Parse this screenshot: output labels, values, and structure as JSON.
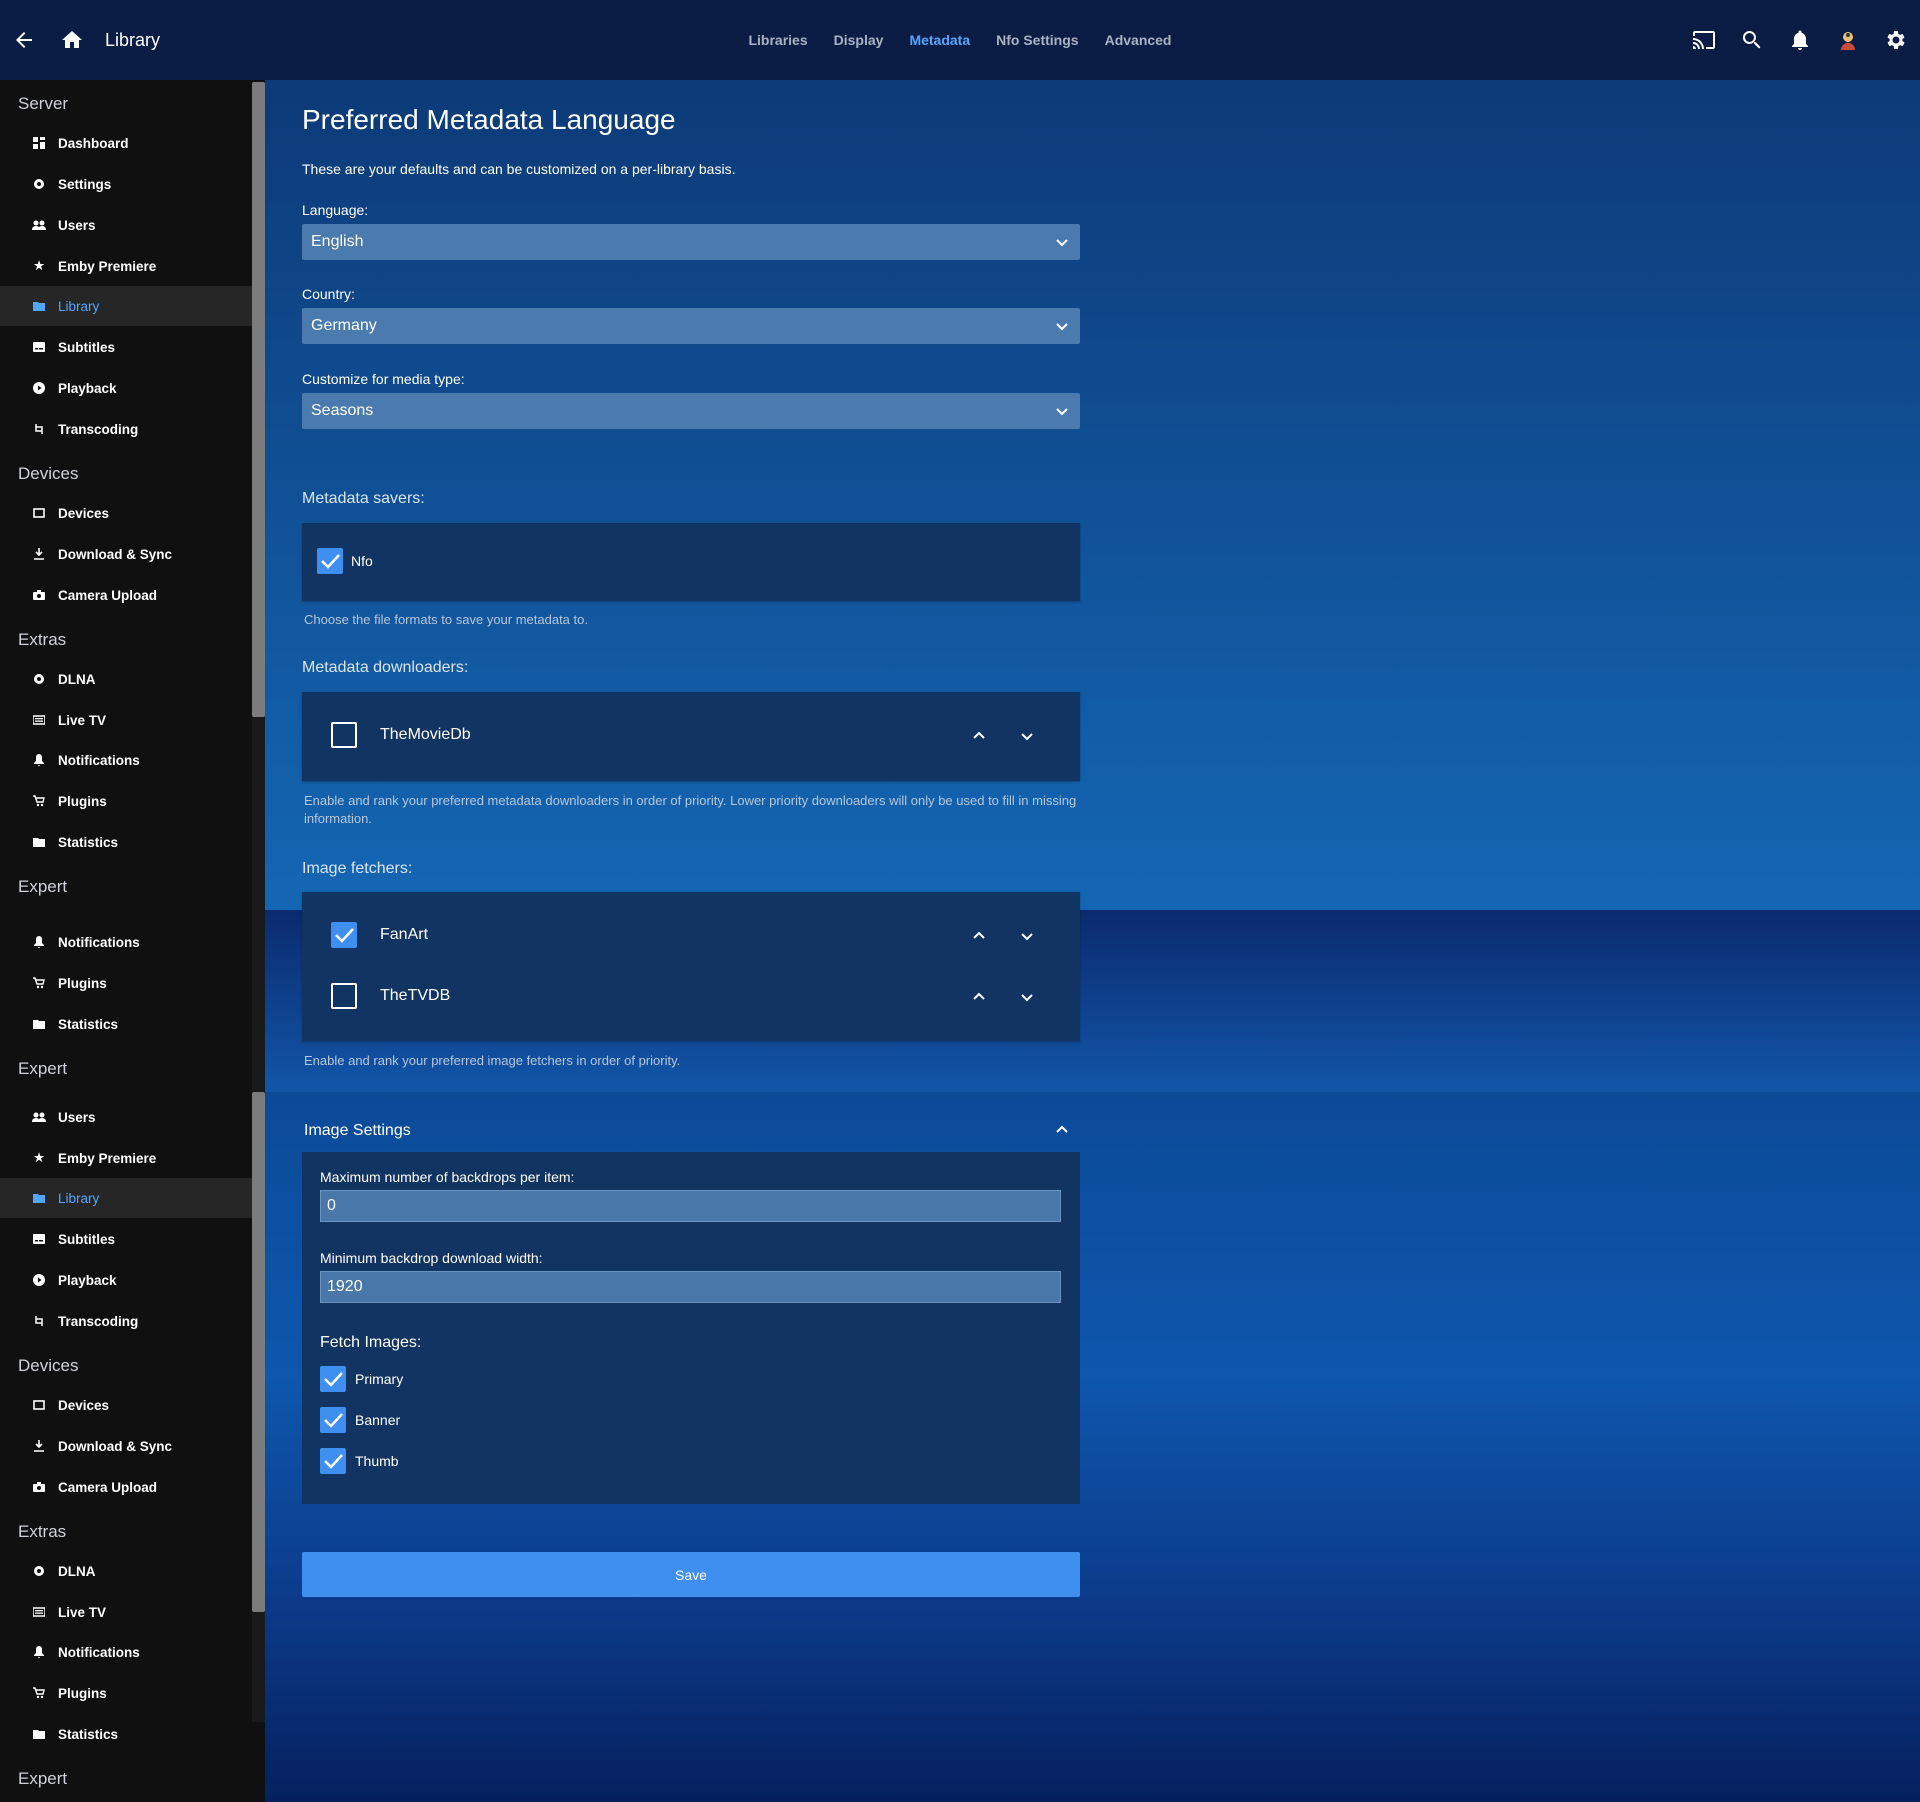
{
  "header": {
    "title": "Library",
    "tabs": [
      "Libraries",
      "Display",
      "Metadata",
      "Nfo Settings",
      "Advanced"
    ],
    "active_tab": "Metadata"
  },
  "sidebar": {
    "sections": [
      {
        "title": "Server",
        "items": [
          "Dashboard",
          "Settings",
          "Users",
          "Emby Premiere",
          "Library",
          "Subtitles",
          "Playback",
          "Transcoding"
        ]
      },
      {
        "title": "Devices",
        "items": [
          "Devices",
          "Download & Sync",
          "Camera Upload"
        ]
      },
      {
        "title": "Extras",
        "items": [
          "DLNA",
          "Live TV",
          "Notifications",
          "Plugins",
          "Statistics"
        ]
      },
      {
        "title": "Expert",
        "items": [
          "Notifications",
          "Plugins",
          "Statistics"
        ]
      },
      {
        "title": "Expert",
        "items": [
          "Users",
          "Emby Premiere",
          "Library",
          "Subtitles",
          "Playback",
          "Transcoding"
        ]
      },
      {
        "title": "Devices",
        "items": [
          "Devices",
          "Download & Sync",
          "Camera Upload"
        ]
      },
      {
        "title": "Extras",
        "items": [
          "DLNA",
          "Live TV",
          "Notifications",
          "Plugins",
          "Statistics"
        ]
      },
      {
        "title": "Expert",
        "items": []
      }
    ],
    "active_item": "Library"
  },
  "main": {
    "title": "Preferred Metadata Language",
    "description": "These are your defaults and can be customized on a per-library basis.",
    "language": {
      "label": "Language:",
      "value": "English"
    },
    "country": {
      "label": "Country:",
      "value": "Germany"
    },
    "media_type": {
      "label": "Customize for media type:",
      "value": "Seasons"
    },
    "metadata_savers": {
      "title": "Metadata savers:",
      "items": [
        {
          "label": "Nfo",
          "checked": true
        }
      ],
      "hint": "Choose the file formats to save your metadata to."
    },
    "metadata_downloaders": {
      "title": "Metadata downloaders:",
      "items": [
        {
          "label": "TheMovieDb",
          "checked": false
        }
      ],
      "hint": "Enable and rank your preferred metadata downloaders in order of priority. Lower priority downloaders will only be used to fill in missing information."
    },
    "image_fetchers": {
      "title": "Image fetchers:",
      "items": [
        {
          "label": "FanArt",
          "checked": true
        },
        {
          "label": "TheTVDB",
          "checked": false
        }
      ],
      "hint": "Enable and rank your preferred image fetchers in order of priority."
    },
    "image_settings": {
      "title": "Image Settings",
      "max_backdrops": {
        "label": "Maximum number of backdrops per item:",
        "value": "0"
      },
      "min_backdrop_width": {
        "label": "Minimum backdrop download width:",
        "value": "1920"
      },
      "fetch_images": {
        "title": "Fetch Images:",
        "items": [
          {
            "label": "Primary",
            "checked": true
          },
          {
            "label": "Banner",
            "checked": true
          },
          {
            "label": "Thumb",
            "checked": true
          }
        ]
      }
    },
    "save_label": "Save"
  },
  "colors": {
    "accent": "#3f8ff0",
    "active_link": "#52a6ff",
    "header_bg": "#0b1d45",
    "sidebar_bg": "#101010"
  }
}
